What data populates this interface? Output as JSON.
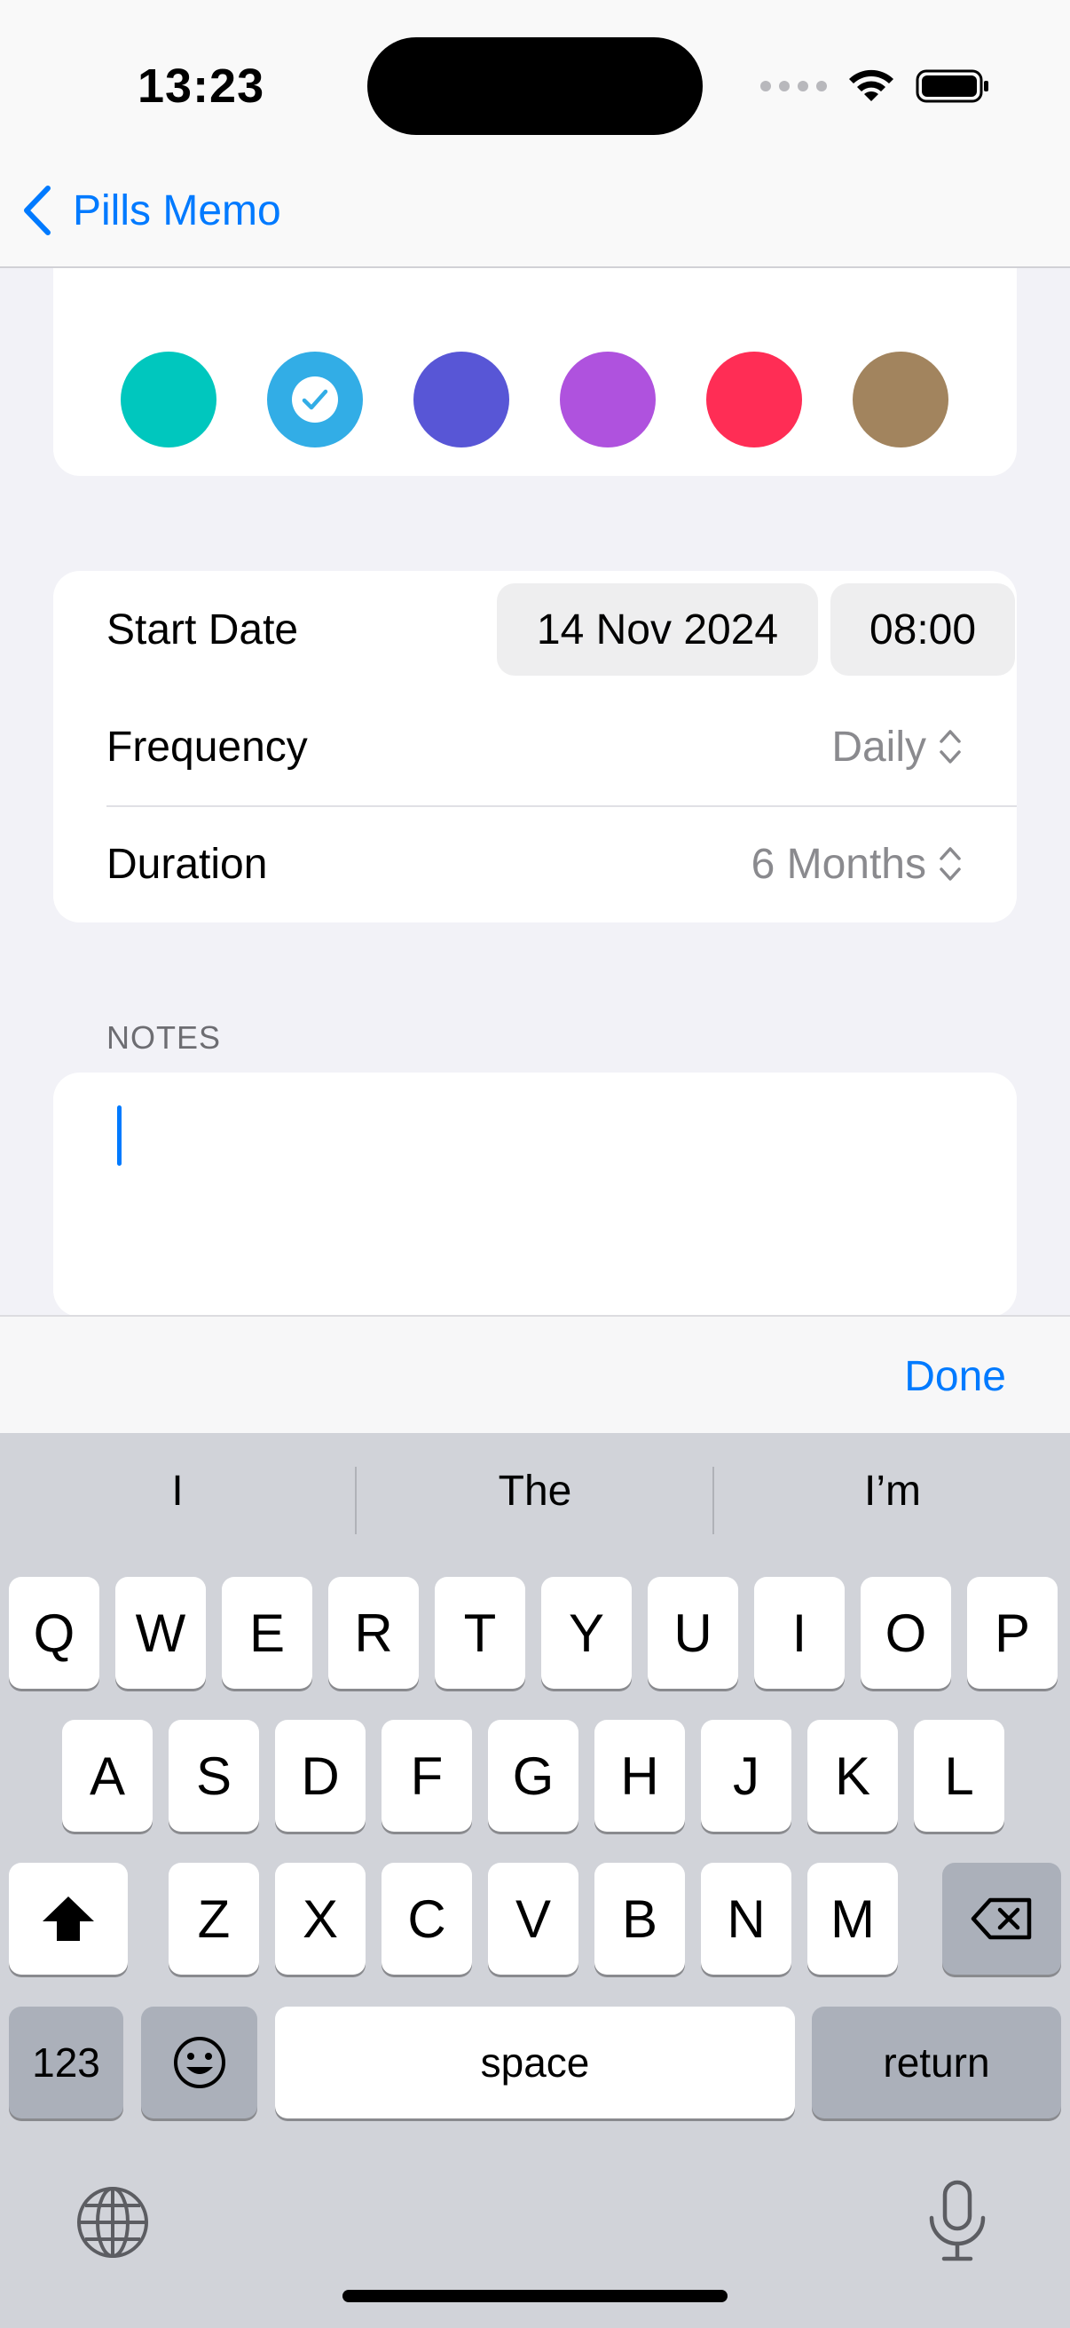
{
  "status_bar": {
    "time": "13:23"
  },
  "nav": {
    "back_label": "Pills Memo"
  },
  "colors": {
    "swatches": [
      "#000000",
      "#8e8e93",
      "#ff3b30",
      "#ff9500",
      "#ffcc00",
      "#34c759",
      "#00c7be",
      "#32ade6",
      "#5856d6",
      "#af52de",
      "#ff2d55",
      "#a2845e"
    ],
    "selected_index": 7,
    "accent": "#007aff"
  },
  "schedule": {
    "start_label": "Start Date",
    "start_date": "14 Nov 2024",
    "start_time": "08:00",
    "frequency_label": "Frequency",
    "frequency_value": "Daily",
    "duration_label": "Duration",
    "duration_value": "6 Months"
  },
  "notes": {
    "header": "NOTES",
    "value": ""
  },
  "accessory": {
    "done_label": "Done"
  },
  "keyboard": {
    "suggestions": [
      "I",
      "The",
      "I’m"
    ],
    "row1": [
      "Q",
      "W",
      "E",
      "R",
      "T",
      "Y",
      "U",
      "I",
      "O",
      "P"
    ],
    "row2": [
      "A",
      "S",
      "D",
      "F",
      "G",
      "H",
      "J",
      "K",
      "L"
    ],
    "row3": [
      "Z",
      "X",
      "C",
      "V",
      "B",
      "N",
      "M"
    ],
    "numbers_label": "123",
    "space_label": "space",
    "return_label": "return"
  }
}
